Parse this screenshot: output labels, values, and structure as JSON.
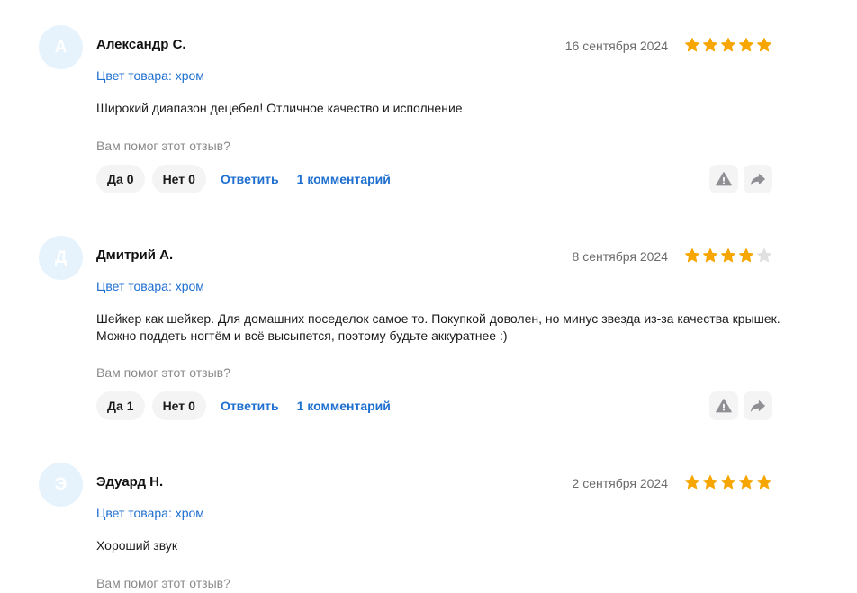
{
  "colors": {
    "star_filled": "#f7a600",
    "star_empty": "#e0e0e0",
    "link": "#1e6fd0",
    "avatar_bg": "#e6f3fd"
  },
  "reviews": [
    {
      "avatar_letter": "А",
      "author": "Александр С.",
      "date": "16 сентября 2024",
      "rating": 5,
      "color_label": "Цвет товара: хром",
      "text": "Широкий диапазон децебел! Отличное качество и исполнение",
      "helpful_question": "Вам помог этот отзыв?",
      "yes_label": "Да",
      "yes_count": "0",
      "no_label": "Нет",
      "no_count": "0",
      "reply_label": "Ответить",
      "comments_label": "1 комментарий"
    },
    {
      "avatar_letter": "Д",
      "author": "Дмитрий А.",
      "date": "8 сентября 2024",
      "rating": 4,
      "color_label": "Цвет товара: хром",
      "text": "Шейкер как шейкер. Для домашних поседелок самое то. Покупкой доволен, но минус звезда из-за качества крышек. Можно поддеть ногтём и всё высыпется, поэтому будьте аккуратнее :)",
      "helpful_question": "Вам помог этот отзыв?",
      "yes_label": "Да",
      "yes_count": "1",
      "no_label": "Нет",
      "no_count": "0",
      "reply_label": "Ответить",
      "comments_label": "1 комментарий"
    },
    {
      "avatar_letter": "Э",
      "author": "Эдуард Н.",
      "date": "2 сентября 2024",
      "rating": 5,
      "color_label": "Цвет товара: хром",
      "text": "Хороший звук",
      "helpful_question": "Вам помог этот отзыв?"
    }
  ]
}
